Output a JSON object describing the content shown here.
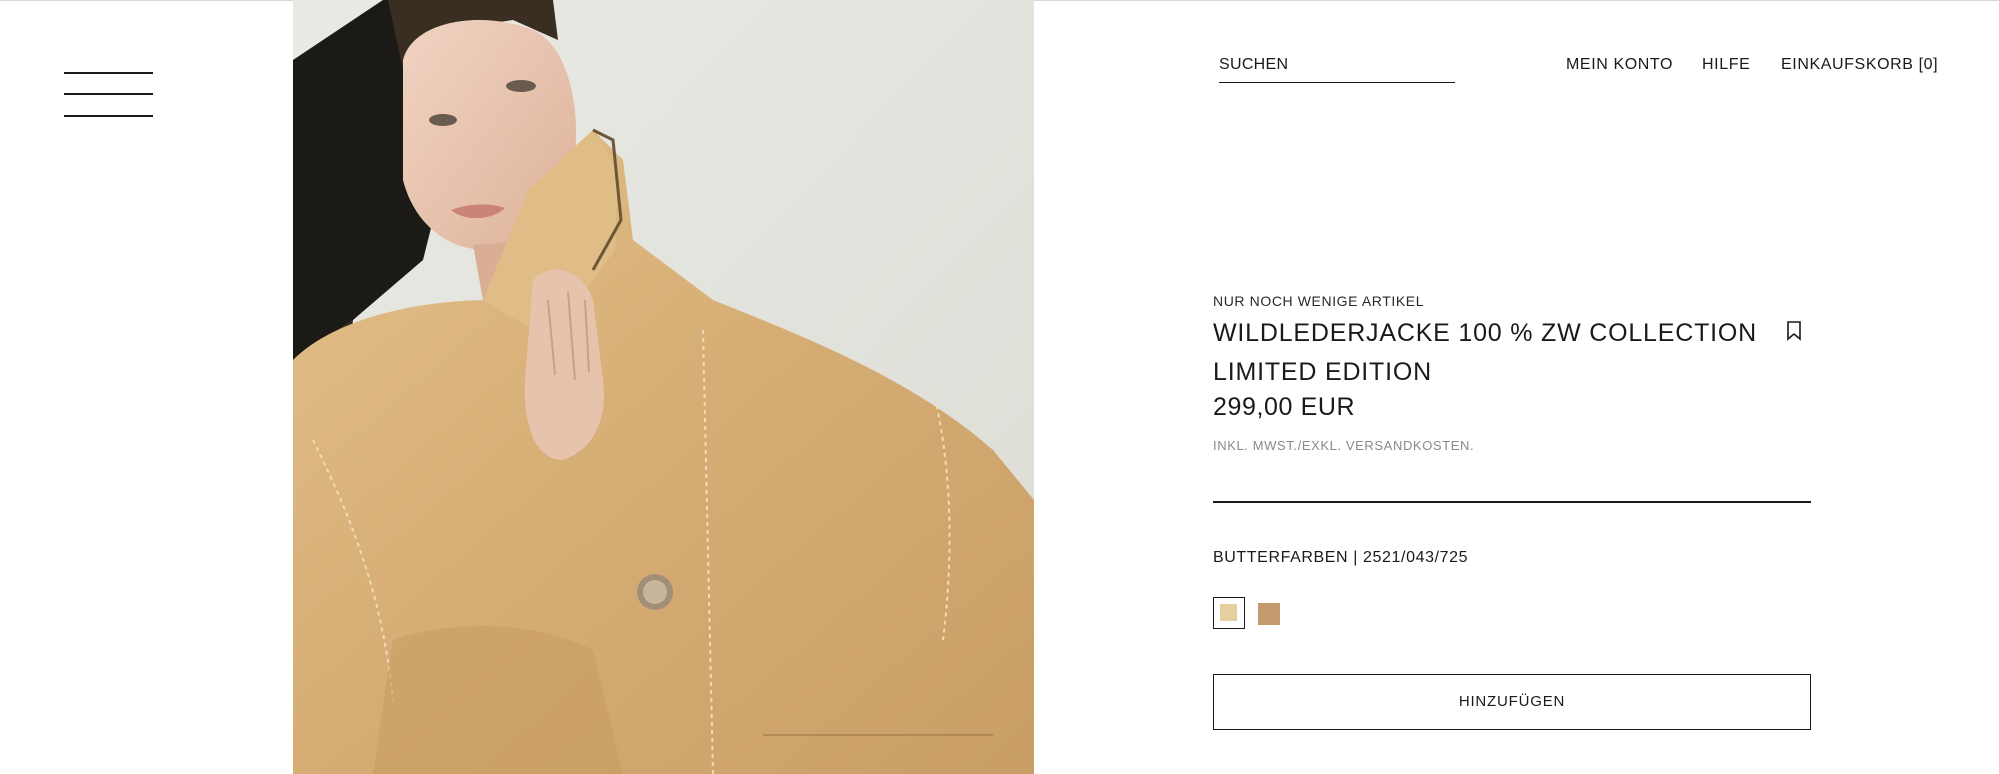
{
  "header": {
    "search_placeholder": "SUCHEN",
    "nav": {
      "account": "MEIN KONTO",
      "help": "HILFE",
      "cart": "EINKAUFSKORB [0]"
    }
  },
  "product": {
    "availability": "NUR NOCH WENIGE ARTIKEL",
    "title_line1": "WILDLEDERJACKE 100 % ZW COLLECTION",
    "title_line2": "LIMITED EDITION",
    "price": "299,00 EUR",
    "tax_note": "INKL. MWST./EXKL. VERSANDKOSTEN.",
    "color_code": "BUTTERFARBEN | 2521/043/725",
    "add_button": "HINZUFÜGEN"
  },
  "swatches": [
    {
      "color": "#e6cf9e",
      "selected": true
    },
    {
      "color": "#c29a6b",
      "selected": false
    }
  ],
  "icons": {
    "menu": "hamburger-menu-icon",
    "bookmark": "bookmark-icon"
  },
  "colors": {
    "text": "#1a1a1a",
    "muted": "#8a8a8a",
    "suede": "#d8b27c"
  }
}
